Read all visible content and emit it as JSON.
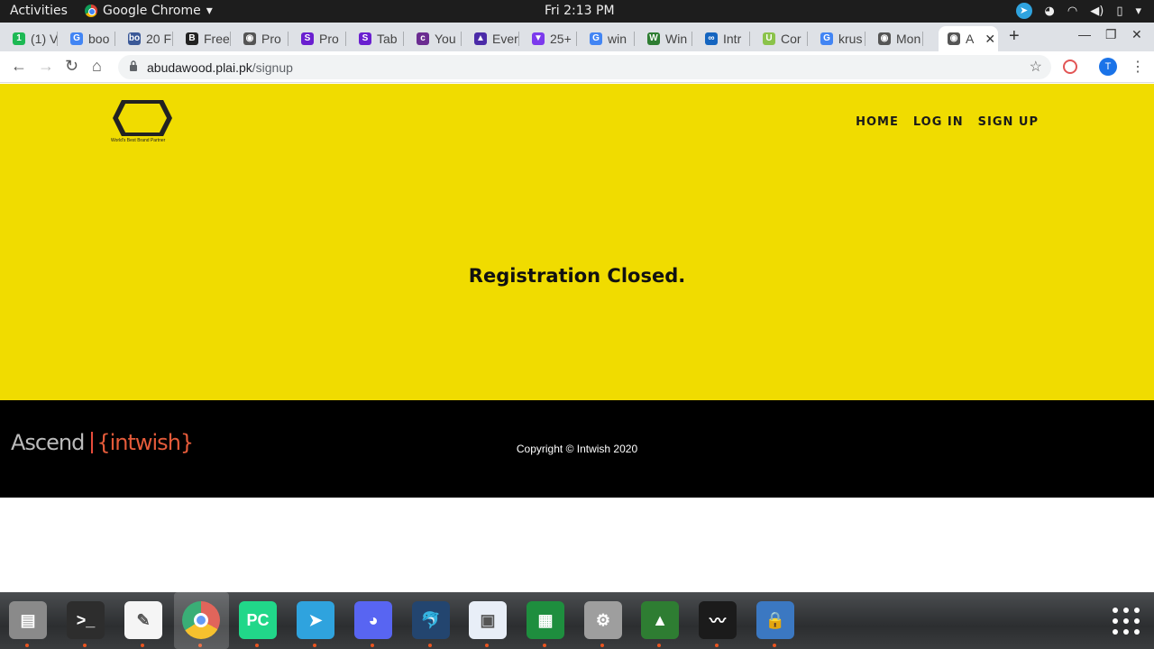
{
  "system": {
    "activities": "Activities",
    "app_name": "Google Chrome",
    "clock": "Fri  2:13 PM"
  },
  "tabs": [
    {
      "label": "(1) V",
      "favicon_color": "#1db954",
      "glyph": "1"
    },
    {
      "label": "boo",
      "favicon_color": "#4285f4",
      "glyph": "G"
    },
    {
      "label": "20 F",
      "favicon_color": "#3b5998",
      "glyph": "bo"
    },
    {
      "label": "Free",
      "favicon_color": "#222222",
      "glyph": "B"
    },
    {
      "label": "Pro",
      "favicon_color": "#555555",
      "glyph": "◉"
    },
    {
      "label": "Pro",
      "favicon_color": "#6a1fd0",
      "glyph": "S"
    },
    {
      "label": "Tab",
      "favicon_color": "#6a1fd0",
      "glyph": "S"
    },
    {
      "label": "You",
      "favicon_color": "#6b2c91",
      "glyph": "c"
    },
    {
      "label": "Ever",
      "favicon_color": "#4b2ba8",
      "glyph": "▲"
    },
    {
      "label": "25+",
      "favicon_color": "#7c3aed",
      "glyph": "▼"
    },
    {
      "label": "win",
      "favicon_color": "#4285f4",
      "glyph": "G"
    },
    {
      "label": "Win",
      "favicon_color": "#2e7d32",
      "glyph": "W"
    },
    {
      "label": "Intr",
      "favicon_color": "#1565c0",
      "glyph": "∞"
    },
    {
      "label": "Cor",
      "favicon_color": "#8bc34a",
      "glyph": "U"
    },
    {
      "label": "krus",
      "favicon_color": "#4285f4",
      "glyph": "G"
    },
    {
      "label": "Mon",
      "favicon_color": "#555555",
      "glyph": "◉"
    },
    {
      "label": "A",
      "favicon_color": "#555555",
      "glyph": "◉",
      "active": true
    }
  ],
  "omnibox": {
    "url_host": "abudawood.plai.pk",
    "url_path": "/signup"
  },
  "profile_initial": "T",
  "site": {
    "logo_tagline": "World's Best Brand Partner",
    "nav": [
      "HOME",
      "LOG IN",
      "SIGN UP"
    ],
    "message": "Registration Closed.",
    "footer_brand": "Ascend",
    "footer_partner": "{intwish}",
    "copyright": "Copyright © Intwish 2020"
  },
  "dock": [
    {
      "name": "files",
      "color": "#8a8a8a",
      "glyph": "▤"
    },
    {
      "name": "terminal",
      "color": "#2d2d2d",
      "glyph": ">_"
    },
    {
      "name": "text-editor",
      "color": "#f5f5f5",
      "glyph": "✎"
    },
    {
      "name": "chrome",
      "color": "#ffffff",
      "glyph": ""
    },
    {
      "name": "pycharm",
      "color": "#21d789",
      "glyph": "PC"
    },
    {
      "name": "telegram",
      "color": "#2fa3de",
      "glyph": "➤"
    },
    {
      "name": "discord",
      "color": "#5865f2",
      "glyph": "◕"
    },
    {
      "name": "mysql-workbench",
      "color": "#23456f",
      "glyph": "🐬"
    },
    {
      "name": "image-viewer",
      "color": "#e8eef7",
      "glyph": "▣"
    },
    {
      "name": "spreadsheet",
      "color": "#1e8e3e",
      "glyph": "▦"
    },
    {
      "name": "settings",
      "color": "#9e9e9e",
      "glyph": "⚙"
    },
    {
      "name": "rocket-launcher",
      "color": "#2e7d32",
      "glyph": "▲"
    },
    {
      "name": "system-monitor",
      "color": "#1b1b1b",
      "glyph": "〰"
    },
    {
      "name": "vpn-lock",
      "color": "#3b78c2",
      "glyph": "🔒"
    }
  ]
}
